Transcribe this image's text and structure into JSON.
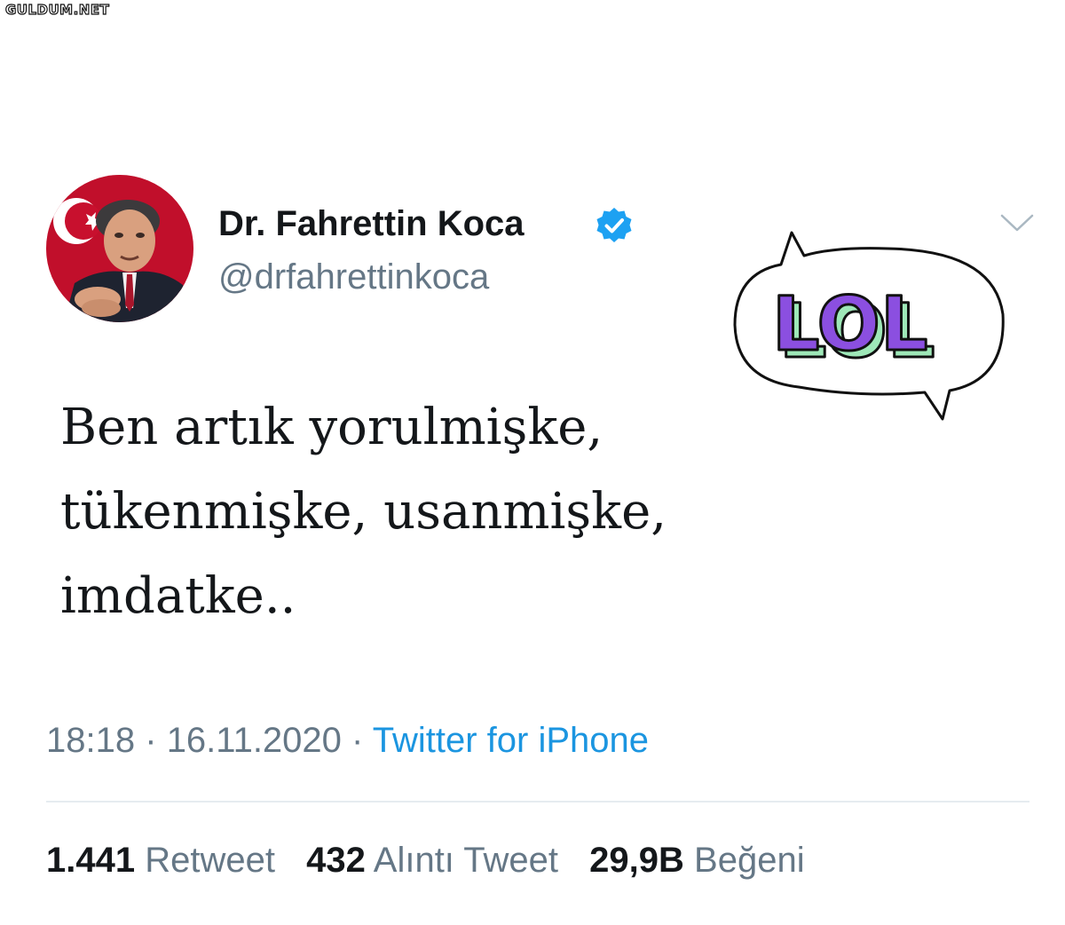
{
  "watermark": "GULDUM.NET",
  "tweet": {
    "display_name": "Dr. Fahrettin Koca",
    "handle": "@drfahrettinkoca",
    "verified": true,
    "text_lines": [
      "Ben artık yorulmişke,",
      "tükenmişke, usanmişke,",
      "imdatke.."
    ],
    "time": "18:18",
    "separator": "·",
    "date": "16.11.2020",
    "source": "Twitter for iPhone"
  },
  "stats": {
    "retweets": {
      "count": "1.441",
      "label": "Retweet"
    },
    "quotes": {
      "count": "432",
      "label": "Alıntı Tweet"
    },
    "likes": {
      "count": "29,9B",
      "label": "Beğeni"
    }
  },
  "sticker": {
    "text": "LOL",
    "colors": {
      "fill": "#8b4fe0",
      "side": "#9ee8b8",
      "outline": "#111111"
    }
  },
  "icons": {
    "avatar": "profile-photo-man-with-turkish-flag",
    "verified": "verified-badge-icon",
    "menu": "chevron-down-icon"
  },
  "colors": {
    "text": "#14171a",
    "secondary": "#657786",
    "link": "#1b95e0",
    "verified": "#1da1f2",
    "divider": "#e6ecf0"
  }
}
